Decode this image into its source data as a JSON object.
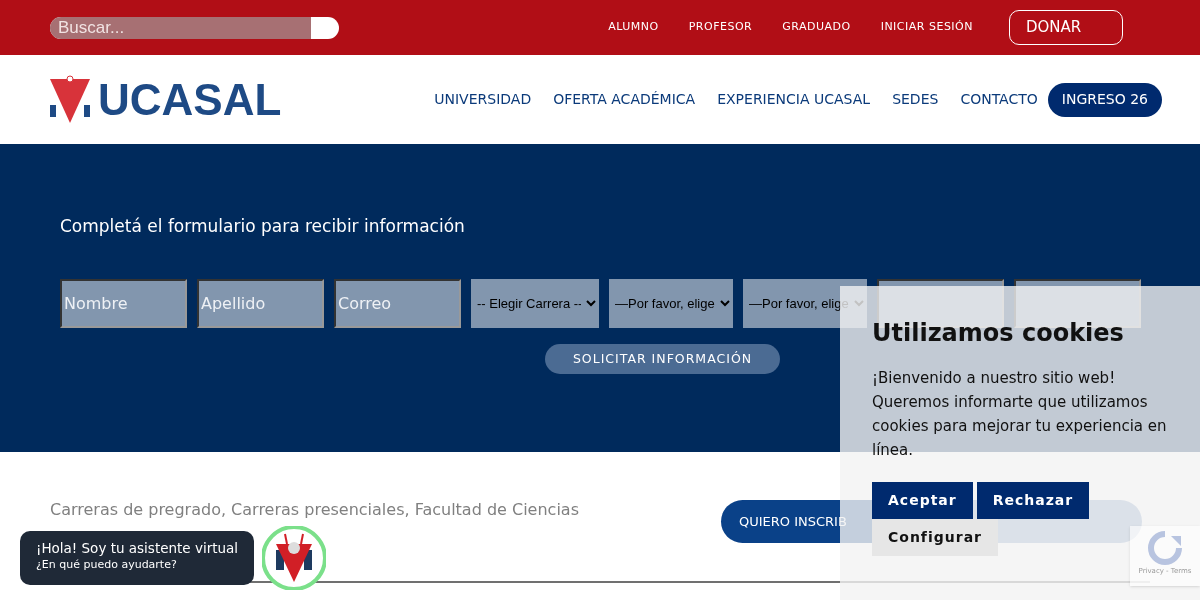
{
  "top_bar": {
    "search": {
      "placeholder": "Buscar..."
    },
    "links": [
      "ALUMNO",
      "PROFESOR",
      "GRADUADO",
      "INICIAR SESIÓN"
    ],
    "donate": "DONAR"
  },
  "nav": {
    "logo": "UCASAL",
    "items": [
      {
        "label": "UNIVERSIDAD",
        "kind": "link"
      },
      {
        "label": "OFERTA ACADÉMICA",
        "kind": "link"
      },
      {
        "label": "EXPERIENCIA UCASAL",
        "kind": "link"
      },
      {
        "label": "SEDES",
        "kind": "link"
      },
      {
        "label": "CONTACTO",
        "kind": "link"
      },
      {
        "label": "INGRESO 26",
        "kind": "pill"
      }
    ]
  },
  "form": {
    "title": "Completá el formulario para recibir información",
    "fields": [
      {
        "kind": "input",
        "placeholder": "Nombre"
      },
      {
        "kind": "input",
        "placeholder": "Apellido"
      },
      {
        "kind": "input",
        "placeholder": "Correo"
      },
      {
        "kind": "select",
        "value": "-- Elegir Carrera --"
      },
      {
        "kind": "select",
        "value": "—Por favor, elige"
      },
      {
        "kind": "select",
        "value": "—Por favor, elige"
      },
      {
        "kind": "input"
      },
      {
        "kind": "input"
      }
    ],
    "submit": "SOLICITAR INFORMACIÓN"
  },
  "course": {
    "categories": "Carreras de pregrado, Carreras presenciales, Facultad de Ciencias",
    "buttons": [
      {
        "label": "QUIERO INSCRIB",
        "kind": "primary"
      },
      {
        "kind": "secondary"
      }
    ]
  },
  "chat": {
    "greeting": "¡Hola! Soy tu asistente virtual",
    "prompt": "¿En qué puedo ayudarte?"
  },
  "cookies": {
    "title": "Utilizamos cookies",
    "text": "¡Bienvenido a nuestro sitio web! Queremos informarte que utilizamos cookies para mejorar tu experiencia en línea.",
    "buttons": [
      {
        "label": "Aceptar",
        "kind": "primary"
      },
      {
        "label": "Rechazar",
        "kind": "primary"
      },
      {
        "label": "Configurar",
        "kind": "plain"
      }
    ]
  },
  "recaptcha": {
    "links": "Privacy - Terms"
  }
}
